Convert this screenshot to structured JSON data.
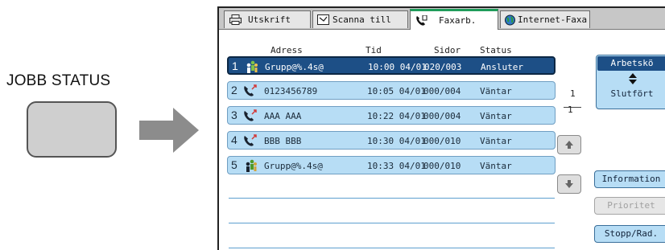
{
  "hardware": {
    "label": "JOBB STATUS"
  },
  "tabs": [
    {
      "label": "Utskrift",
      "icon": "printer-icon",
      "active": false
    },
    {
      "label": "Scanna till",
      "icon": "scan-icon",
      "active": false
    },
    {
      "label": "Faxarb.",
      "icon": "fax-phone-icon",
      "active": true
    },
    {
      "label": "Internet-Faxa",
      "icon": "globe-icon",
      "active": false
    }
  ],
  "columns": {
    "address": "Adress",
    "time": "Tid",
    "pages": "Sidor",
    "status": "Status"
  },
  "jobs": [
    {
      "num": "1",
      "icon": "group-icon",
      "address": "Grupp@%.4s@",
      "time": "10:00 04/01",
      "pages": "020/003",
      "status": "Ansluter",
      "selected": true
    },
    {
      "num": "2",
      "icon": "phone-icon",
      "address": "0123456789",
      "time": "10:05 04/01",
      "pages": "000/004",
      "status": "Väntar",
      "selected": false
    },
    {
      "num": "3",
      "icon": "phone-icon",
      "address": "AAA AAA",
      "time": "10:22 04/01",
      "pages": "000/004",
      "status": "Väntar",
      "selected": false
    },
    {
      "num": "4",
      "icon": "phone-icon",
      "address": "BBB BBB",
      "time": "10:30 04/01",
      "pages": "000/010",
      "status": "Väntar",
      "selected": false
    },
    {
      "num": "5",
      "icon": "group-icon",
      "address": "Grupp@%.4s@",
      "time": "10:33 04/01",
      "pages": "000/010",
      "status": "Väntar",
      "selected": false
    }
  ],
  "pager": {
    "current": "1",
    "total": "1"
  },
  "side": {
    "toggle_top": "Arbetskö",
    "toggle_bottom": "Slutfört",
    "information": "Information",
    "priority": "Prioritet",
    "stop_delete": "Stopp/Rad."
  },
  "colors": {
    "row_fill": "#b7ddf5",
    "row_selected": "#1d4f86",
    "active_tab_accent": "#1f9c5a"
  }
}
